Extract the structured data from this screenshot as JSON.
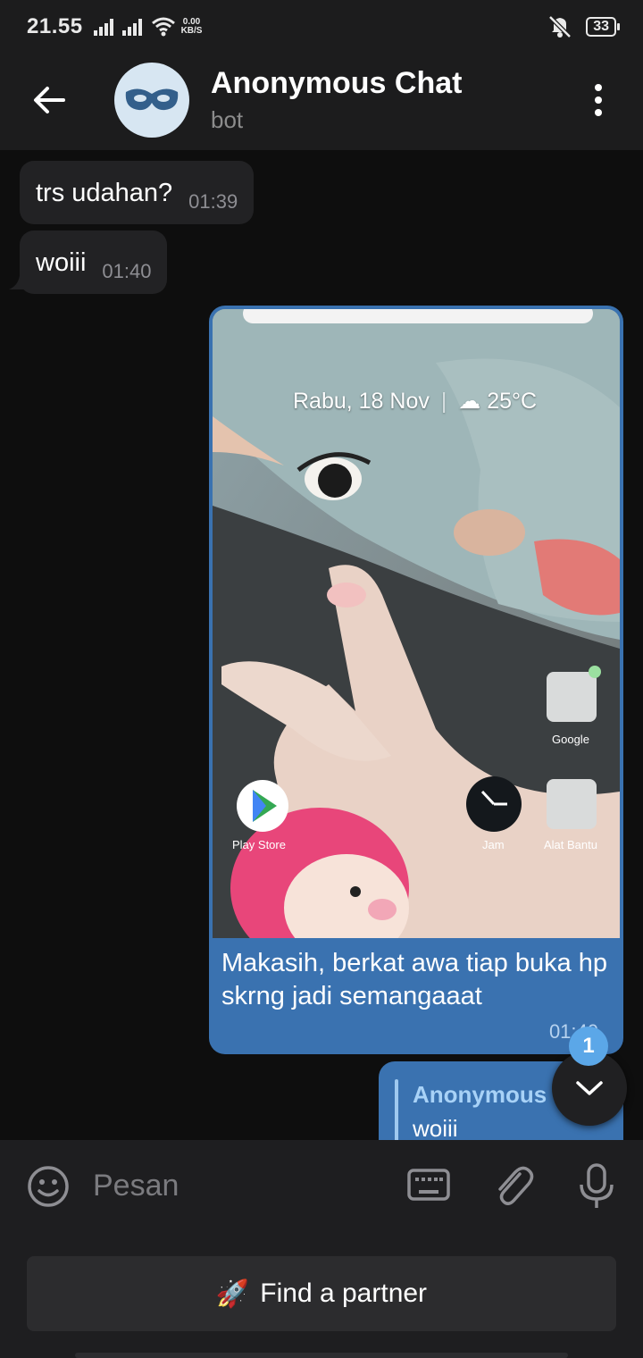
{
  "status_bar": {
    "time": "21.55",
    "speed_value": "0.00",
    "speed_unit": "KB/S",
    "battery": "33"
  },
  "header": {
    "title": "Anonymous Chat",
    "subtitle": "bot",
    "avatar_icon": "mask-icon"
  },
  "messages": [
    {
      "direction": "in",
      "text": "trs udahan?",
      "time": "01:39"
    },
    {
      "direction": "in",
      "text": "woiii",
      "time": "01:40"
    },
    {
      "direction": "out",
      "type": "photo",
      "caption": "Makasih, berkat awa tiap buka hp skrng jadi semangaaat",
      "time": "01:40",
      "photo": {
        "date_widget": "Rabu, 18 Nov",
        "weather": "25°C",
        "apps": [
          "Google",
          "Play Store",
          "Jam",
          "Alat Bantu"
        ]
      }
    },
    {
      "direction": "out",
      "type": "reply",
      "reply_to_name": "Anonymous",
      "reply_to_text": "woiii"
    }
  ],
  "scroll_badge": "1",
  "composer": {
    "placeholder": "Pesan"
  },
  "bottom_button": {
    "icon": "🚀",
    "label": "Find a partner"
  },
  "colors": {
    "outgoing": "#3a72b0",
    "incoming": "#222224",
    "accent": "#5ba7e8"
  }
}
